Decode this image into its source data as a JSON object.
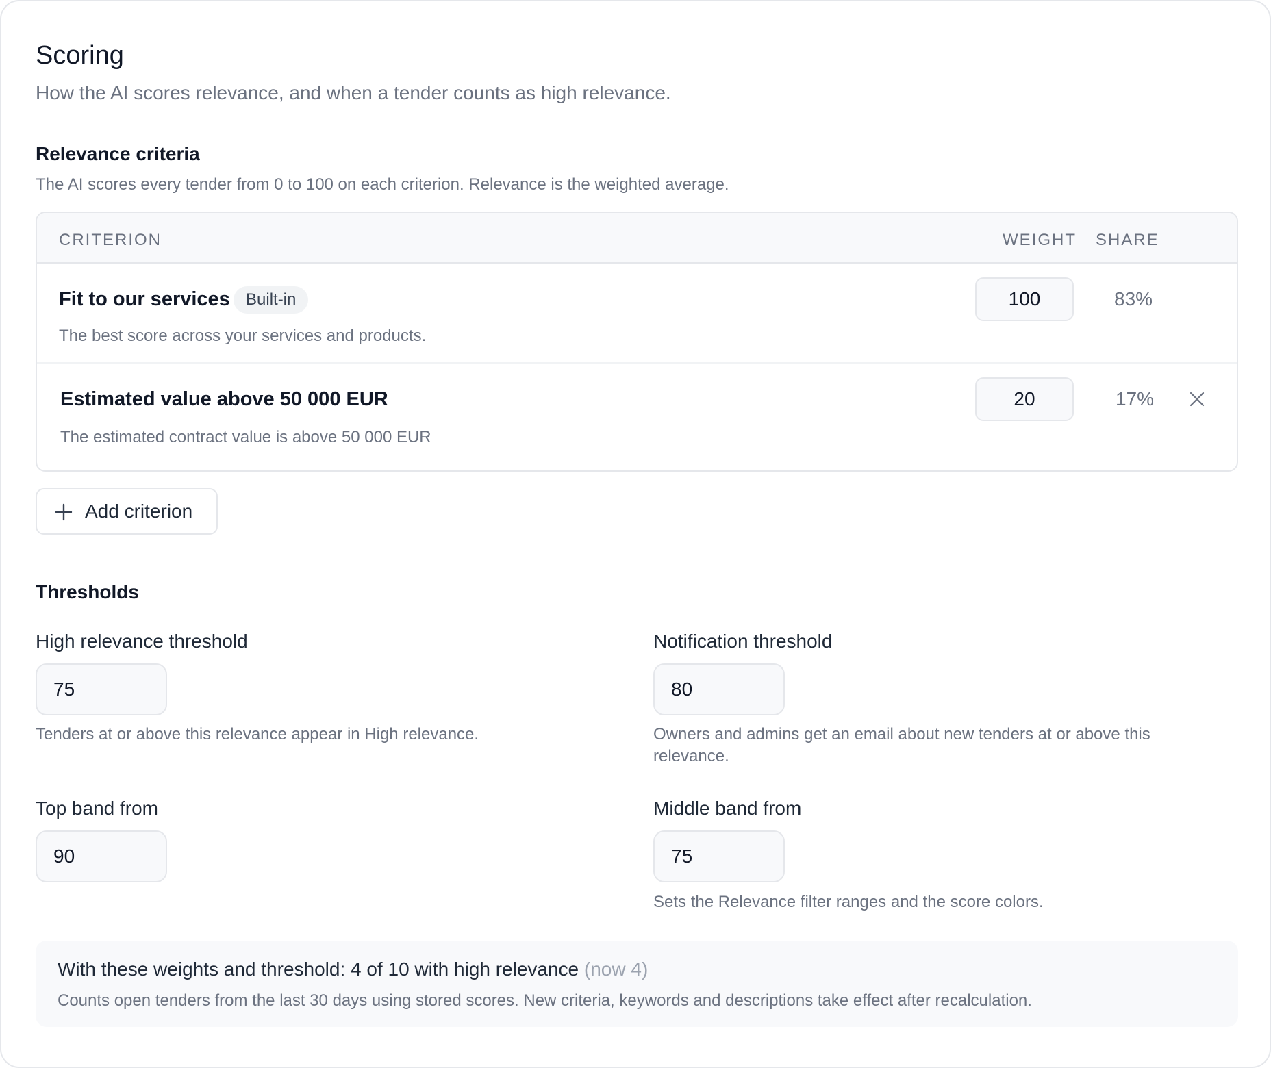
{
  "page": {
    "title": "Scoring",
    "subtitle": "How the AI scores relevance, and when a tender counts as high relevance."
  },
  "criteria": {
    "title": "Relevance criteria",
    "description": "The AI scores every tender from 0 to 100 on each criterion. Relevance is the weighted average.",
    "columns": {
      "criterion": "CRITERION",
      "weight": "WEIGHT",
      "share": "SHARE"
    },
    "rows": [
      {
        "name": "Fit to our services",
        "badge": "Built-in",
        "description": "The best score across your services and products.",
        "weight": "100",
        "share": "83%"
      },
      {
        "name": "Estimated value above 50 000 EUR",
        "description": "The estimated contract value is above 50 000 EUR",
        "weight": "20",
        "share": "17%",
        "remove_icon": "close-icon"
      }
    ],
    "add_label": "Add criterion",
    "add_icon": "plus-icon"
  },
  "thresholds": {
    "title": "Thresholds",
    "high": {
      "label": "High relevance threshold",
      "value": "75",
      "help": "Tenders at or above this relevance appear in High relevance."
    },
    "notification": {
      "label": "Notification threshold",
      "value": "80",
      "help": "Owners and admins get an email about new tenders at or above this relevance."
    },
    "top_band": {
      "label": "Top band from",
      "value": "90"
    },
    "middle_band": {
      "label": "Middle band from",
      "value": "75",
      "help": "Sets the Relevance filter ranges and the score colors."
    }
  },
  "summary": {
    "main": "With these weights and threshold: 4 of 10 with high relevance",
    "now": "(now 4)",
    "note": "Counts open tenders from the last 30 days using stored scores. New criteria, keywords and descriptions take effect after recalculation."
  }
}
